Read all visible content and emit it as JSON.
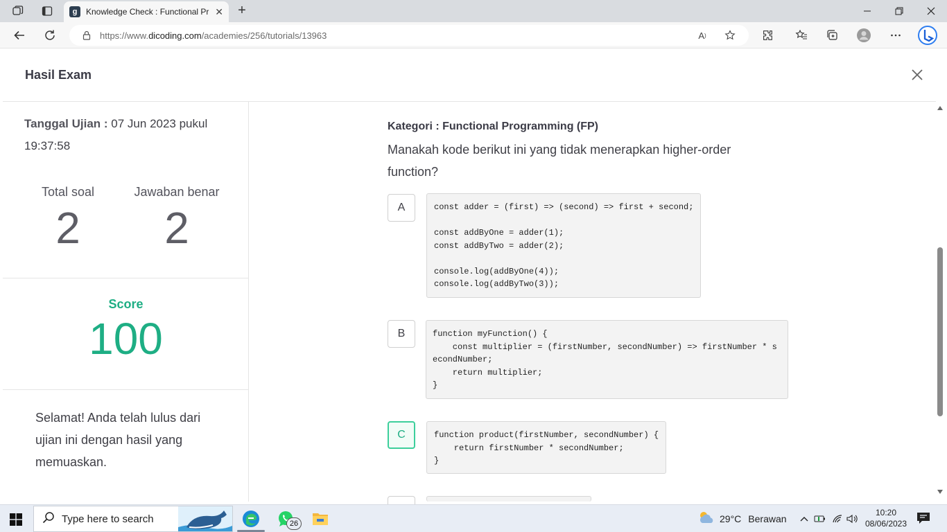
{
  "browser": {
    "tab_title": "Knowledge Check : Functional Pr",
    "favicon_letter": "g",
    "url_prefix": "https://www.",
    "url_domain": "dicoding.com",
    "url_path": "/academies/256/tutorials/13963",
    "read_aloud_label": "A",
    "read_aloud_sup": "̀"
  },
  "modal": {
    "title": "Hasil Exam"
  },
  "summary": {
    "date_label": "Tanggal Ujian :",
    "date_value": " 07 Jun 2023 pukul 19:37:58",
    "total_label": "Total soal",
    "total_value": "2",
    "correct_label": "Jawaban benar",
    "correct_value": "2",
    "score_label": "Score",
    "score_value": "100",
    "message": "Selamat! Anda telah lulus dari ujian ini dengan hasil yang memuaskan."
  },
  "question": {
    "category": "Kategori : Functional Programming (FP)",
    "text": "Manakah kode berikut ini yang tidak menerapkan higher-order function?",
    "options": [
      {
        "letter": "A",
        "code": "const adder = (first) => (second) => first + second;\n\nconst addByOne = adder(1);\nconst addByTwo = adder(2);\n\nconsole.log(addByOne(4));\nconsole.log(addByTwo(3));"
      },
      {
        "letter": "B",
        "code": "function myFunction() {\n    const multiplier = (firstNumber, secondNumber) => firstNumber * s\necondNumber;\n    return multiplier;\n}"
      },
      {
        "letter": "C",
        "code": "function product(firstNumber, secondNumber) {\n    return firstNumber * secondNumber;\n}"
      }
    ]
  },
  "taskbar": {
    "search_placeholder": "Type here to search",
    "whatsapp_badge": "26",
    "temperature": "29°C",
    "weather": "Berawan",
    "time": "10:20",
    "date": "08/06/2023"
  },
  "colors": {
    "accent_green": "#1eae84",
    "correct_border": "#3ccf9b"
  }
}
